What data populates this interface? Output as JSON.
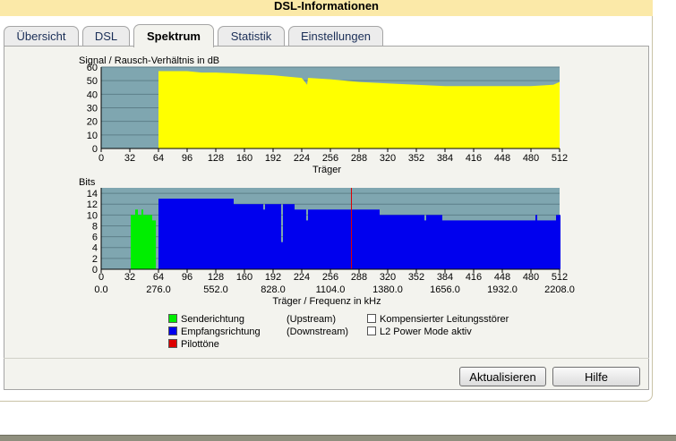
{
  "window": {
    "title": "DSL-Informationen"
  },
  "tabs": [
    {
      "label": "Übersicht",
      "active": false
    },
    {
      "label": "DSL",
      "active": false
    },
    {
      "label": "Spektrum",
      "active": true
    },
    {
      "label": "Statistik",
      "active": false
    },
    {
      "label": "Einstellungen",
      "active": false
    }
  ],
  "legend": {
    "send": "Senderichtung",
    "send_dir": "(Upstream)",
    "recv": "Empfangsrichtung",
    "recv_dir": "(Downstream)",
    "pilot": "Pilottöne",
    "kls": "Kompensierter Leitungsstörer",
    "l2": "L2 Power Mode aktiv"
  },
  "buttons": {
    "refresh": "Aktualisieren",
    "help": "Hilfe"
  },
  "colors": {
    "plot_bg": "#7fa6b0",
    "snr": "#ffff00",
    "upstream": "#00ee00",
    "downstream": "#0000ee",
    "pilot": "#dd0000",
    "grid": "#5d7f89"
  },
  "chart_data": [
    {
      "type": "area",
      "title": "Signal / Rausch-Verhältnis in dB",
      "xlabel": "Träger",
      "ylabel": "",
      "xlim": [
        0,
        512
      ],
      "ylim": [
        0,
        60
      ],
      "x_ticks": [
        0,
        32,
        64,
        96,
        128,
        160,
        192,
        224,
        256,
        288,
        320,
        352,
        384,
        416,
        448,
        480,
        512
      ],
      "y_ticks": [
        0,
        10,
        20,
        30,
        40,
        50,
        60
      ],
      "grid": true,
      "series": [
        {
          "x": [
            64,
            65,
            80,
            96,
            112,
            128,
            160,
            192,
            224,
            230,
            231,
            232,
            256,
            288,
            320,
            352,
            384,
            416,
            448,
            480,
            505,
            512
          ],
          "y": [
            57,
            57,
            57,
            57,
            56,
            56,
            55,
            54,
            52,
            47,
            52,
            52,
            51,
            49,
            48,
            47,
            46,
            46,
            46,
            46,
            47,
            49
          ]
        }
      ]
    },
    {
      "type": "bar",
      "title": "Bits",
      "xlabel": "Träger / Frequenz in kHz",
      "xlim": [
        0,
        512
      ],
      "ylim": [
        0,
        15
      ],
      "x_ticks": [
        0,
        32,
        64,
        96,
        128,
        160,
        192,
        224,
        256,
        288,
        320,
        352,
        384,
        416,
        448,
        480,
        512
      ],
      "x_ticks_khz": [
        "0.0",
        "276.0",
        "552.0",
        "828.0",
        "1104.0",
        "1380.0",
        "1656.0",
        "1932.0",
        "2208.0"
      ],
      "y_ticks": [
        0,
        2,
        4,
        6,
        8,
        10,
        12,
        14
      ],
      "grid": true,
      "series": [
        {
          "name": "Senderichtung",
          "segments": [
            [
              33,
              37,
              10
            ],
            [
              38,
              40,
              11
            ],
            [
              41,
              44,
              10
            ],
            [
              45,
              46,
              11
            ],
            [
              47,
              56,
              10
            ],
            [
              57,
              60,
              9
            ]
          ]
        },
        {
          "name": "Empfangsrichtung",
          "segments": [
            [
              64,
              147,
              13
            ],
            [
              148,
              180,
              12
            ],
            [
              181,
              182,
              11
            ],
            [
              183,
              200,
              12
            ],
            [
              201,
              202,
              5
            ],
            [
              203,
              215,
              12
            ],
            [
              216,
              228,
              11
            ],
            [
              229,
              230,
              9
            ],
            [
              231,
              279,
              11
            ],
            [
              280,
              310,
              11
            ],
            [
              311,
              360,
              10
            ],
            [
              361,
              362,
              9
            ],
            [
              363,
              380,
              10
            ],
            [
              381,
              382,
              9
            ],
            [
              383,
              484,
              9
            ],
            [
              485,
              486,
              10
            ],
            [
              487,
              507,
              9
            ],
            [
              508,
              512,
              10
            ]
          ]
        },
        {
          "name": "Pilottöne",
          "x": [
            279
          ]
        }
      ]
    }
  ]
}
